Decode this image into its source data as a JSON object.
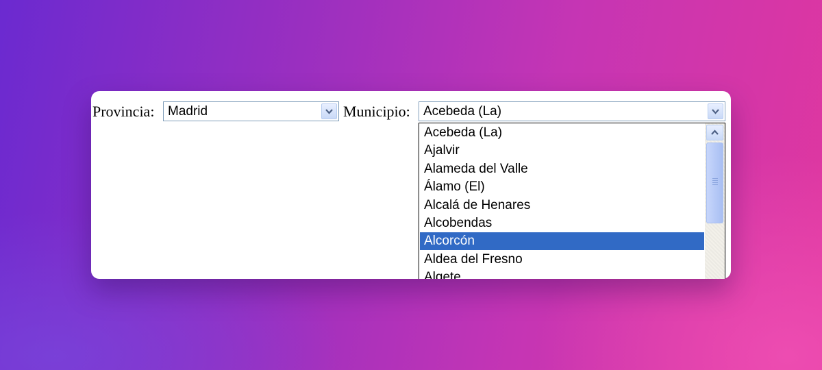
{
  "form": {
    "provincia_label": "Provincia:",
    "provincia_value": "Madrid",
    "municipio_label": "Municipio:",
    "municipio_value": "Acebeda (La)"
  },
  "municipio_options": [
    {
      "label": "Acebeda (La)",
      "selected": false
    },
    {
      "label": "Ajalvir",
      "selected": false
    },
    {
      "label": "Alameda del Valle",
      "selected": false
    },
    {
      "label": "Álamo (El)",
      "selected": false
    },
    {
      "label": "Alcalá de Henares",
      "selected": false
    },
    {
      "label": "Alcobendas",
      "selected": false
    },
    {
      "label": "Alcorcón",
      "selected": true
    },
    {
      "label": "Aldea del Fresno",
      "selected": false
    },
    {
      "label": "Algete",
      "selected": false
    }
  ],
  "icons": {
    "dropdown": "chevron-down-icon",
    "scroll_up": "chevron-up-icon"
  },
  "colors": {
    "highlight": "#316ac5",
    "field_border": "#7f9db9"
  }
}
